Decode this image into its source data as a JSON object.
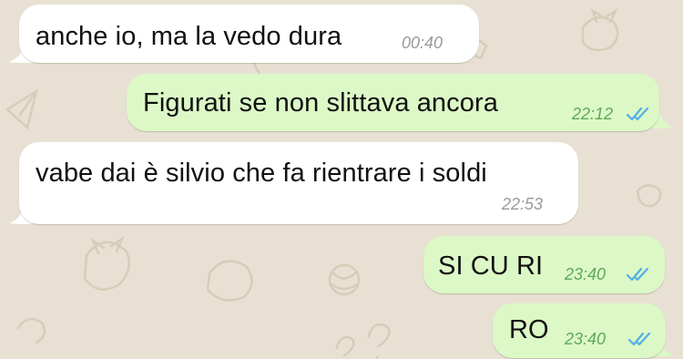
{
  "chat": {
    "messages": [
      {
        "direction": "incoming",
        "text": "anche io, ma la vedo dura",
        "time": "00:40"
      },
      {
        "direction": "outgoing",
        "text": "Figurati se non slittava ancora",
        "time": "22:12",
        "status": "read"
      },
      {
        "direction": "incoming",
        "text": "vabe dai è silvio che fa rientrare i soldi",
        "time": "22:53"
      },
      {
        "direction": "outgoing",
        "text": "SI CU RI",
        "time": "23:40",
        "status": "read"
      },
      {
        "direction": "outgoing",
        "text": "RO",
        "time": "23:40",
        "status": "read"
      }
    ]
  },
  "colors": {
    "incoming_bubble": "#ffffff",
    "outgoing_bubble": "#dcf8c6",
    "read_ticks": "#4fb0ea",
    "outgoing_time": "#5fa85b",
    "wallpaper": "#e8e1d3"
  },
  "icons": {
    "read_status": "double-check-icon",
    "wallpaper": "doodle-pattern"
  }
}
